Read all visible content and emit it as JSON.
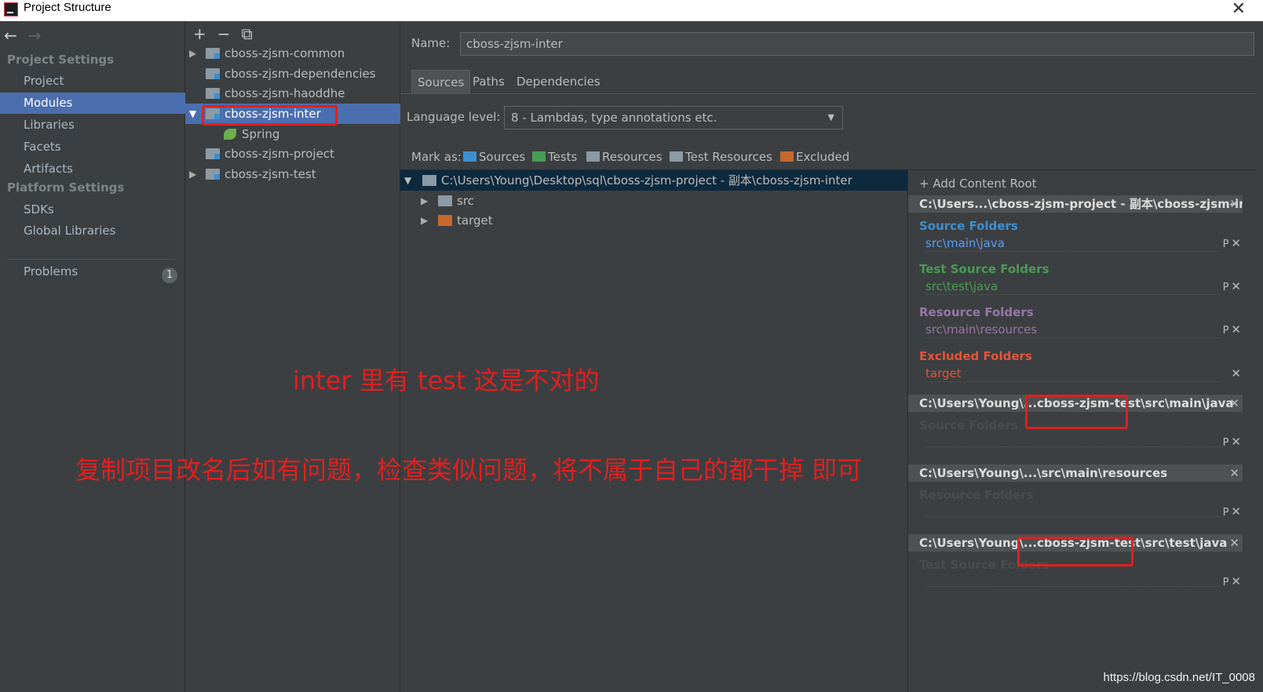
{
  "window": {
    "title": "Project Structure",
    "close_glyph": "✕"
  },
  "nav": {
    "back_glyph": "←",
    "forward_glyph": "→",
    "project_settings_title": "Project Settings",
    "project_settings": [
      "Project",
      "Modules",
      "Libraries",
      "Facets",
      "Artifacts"
    ],
    "selected": "Modules",
    "platform_settings_title": "Platform Settings",
    "platform_settings": [
      "SDKs",
      "Global Libraries"
    ],
    "problems_label": "Problems",
    "problems_count": "1"
  },
  "module_toolbar": {
    "add": "+",
    "remove": "−",
    "copy": "⧉"
  },
  "modules": [
    {
      "label": "cboss-zjsm-common",
      "arrow": "▶"
    },
    {
      "label": "cboss-zjsm-dependencies",
      "arrow": ""
    },
    {
      "label": "cboss-zjsm-haoddhe",
      "arrow": ""
    },
    {
      "label": "cboss-zjsm-inter",
      "arrow": "▼",
      "selected": true
    },
    {
      "label": "Spring",
      "arrow": "",
      "child": true
    },
    {
      "label": "cboss-zjsm-project",
      "arrow": ""
    },
    {
      "label": "cboss-zjsm-test",
      "arrow": "▶"
    }
  ],
  "detail": {
    "name_label": "Name:",
    "name_value": "cboss-zjsm-inter",
    "tabs": [
      "Sources",
      "Paths",
      "Dependencies"
    ],
    "active_tab": "Sources",
    "language_label": "Language level:",
    "language_value": "8 - Lambdas, type annotations etc.",
    "mark_as_label": "Mark as:",
    "mark_buttons": [
      {
        "label": "Sources",
        "color": "#3d8fd1"
      },
      {
        "label": "Tests",
        "color": "#499c54"
      },
      {
        "label": "Resources",
        "color": "#8c9aa5"
      },
      {
        "label": "Test Resources",
        "color": "#8c9aa5"
      },
      {
        "label": "Excluded",
        "color": "#c5692c"
      }
    ]
  },
  "content_tree": {
    "root_arrow": "▼",
    "root_path": "C:\\Users\\Young\\Desktop\\sql\\cboss-zjsm-project - 副本\\cboss-zjsm-inter",
    "children": [
      {
        "label": "src",
        "arrow": "▶",
        "color": "#8c9aa5"
      },
      {
        "label": "target",
        "arrow": "▶",
        "color": "#c5692c"
      }
    ]
  },
  "roots_panel": {
    "add_label": "+ Add Content Root",
    "roots": [
      {
        "header": "C:\\Users...\\cboss-zjsm-project - 副本\\cboss-zjsm-inter",
        "x": "✕"
      },
      {
        "header": "C:\\Users\\Young\\...cboss-zjsm-test\\src\\main\\java",
        "x": "✕"
      },
      {
        "header": "C:\\Users\\Young\\...\\src\\main\\resources",
        "x": "✕"
      },
      {
        "header": "C:\\Users\\Young\\...cboss-zjsm-test\\src\\test\\java",
        "x": "✕"
      }
    ],
    "groups": [
      {
        "title": "Source Folders",
        "entry": "src\\main\\java",
        "title_color": "#3d8fd1",
        "entry_color": "#589df6"
      },
      {
        "title": "Test Source Folders",
        "entry": "src\\test\\java",
        "title_color": "#499c54",
        "entry_color": "#499c54"
      },
      {
        "title": "Resource Folders",
        "entry": "src\\main\\resources",
        "title_color": "#9876aa",
        "entry_color": "#9876aa"
      },
      {
        "title": "Excluded Folders",
        "entry": "target",
        "title_color": "#e5533c",
        "entry_color": "#e5533c"
      },
      {
        "title": "Source Folders",
        "entry": "",
        "title_color": "#4a4d4f",
        "entry_color": "#4a4d4f"
      },
      {
        "title": "Resource Folders",
        "entry": "",
        "title_color": "#4a4d4f",
        "entry_color": "#4a4d4f"
      },
      {
        "title": "Test Source Folders",
        "entry": "",
        "title_color": "#4a4d4f",
        "entry_color": "#4a4d4f"
      }
    ],
    "entry_action": "P",
    "entry_close": "✕"
  },
  "annotations": {
    "line1": "inter 里有 test  这是不对的",
    "line2": "复制项目改名后如有问题，检查类似问题，将不属于自己的都干掉 即可",
    "color": "#e02020"
  },
  "watermark": "https://blog.csdn.net/IT_0008"
}
